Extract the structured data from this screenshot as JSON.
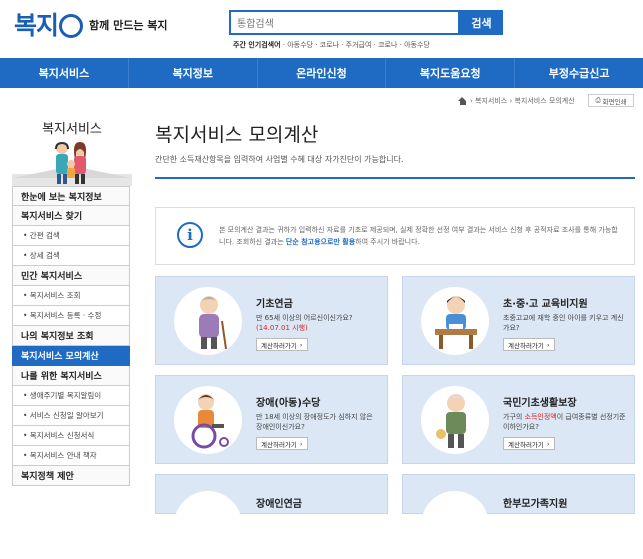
{
  "header": {
    "logo_text": "복지",
    "slogan": "함께 만드는 복지",
    "search_placeholder": "통합검색",
    "search_button": "검색",
    "popular_label": "주간 인기검색어",
    "popular_terms": "· 아동수당 · 코로나 · 주거급여 · 코로나 · 아동수당"
  },
  "nav": {
    "items": [
      "복지서비스",
      "복지정보",
      "온라인신청",
      "복지도움요청",
      "부정수급신고"
    ]
  },
  "breadcrumb": {
    "path": "› 복지서비스 › 복지서비스 모의계산",
    "print": "화면인쇄"
  },
  "sidebar": {
    "title": "복지서비스",
    "items": [
      {
        "label": "한눈에 보는 복지정보",
        "type": "main"
      },
      {
        "label": "복지서비스 찾기",
        "type": "main"
      },
      {
        "label": "• 간편 검색",
        "type": "sub"
      },
      {
        "label": "• 상세 검색",
        "type": "sub"
      },
      {
        "label": "민간 복지서비스",
        "type": "main"
      },
      {
        "label": "• 복지서비스 조회",
        "type": "sub"
      },
      {
        "label": "• 복지서비스 등록 · 수정",
        "type": "sub"
      },
      {
        "label": "나의 복지정보 조회",
        "type": "main"
      },
      {
        "label": "복지서비스 모의계산",
        "type": "active"
      },
      {
        "label": "나를 위한 복지서비스",
        "type": "main"
      },
      {
        "label": "• 생애주기별 복지알림이",
        "type": "sub"
      },
      {
        "label": "• 서비스 신청일 알아보기",
        "type": "sub"
      },
      {
        "label": "• 복지서비스 신청서식",
        "type": "sub"
      },
      {
        "label": "• 복지서비스 안내 책자",
        "type": "sub"
      },
      {
        "label": "복지정책 제안",
        "type": "main"
      }
    ]
  },
  "main": {
    "title": "복지서비스 모의계산",
    "description": "간단한 소득재산항목을 입력하여 사업별 수혜 대상 자가진단이 가능합니다.",
    "notice_1": "본 모의계산 결과는 귀하가 입력하신 자료를 기초로 제공되며, 실제 정확한 선정 여부 결과는 서비스 신청 후 공적자료 조사를 통해 가능합니다. 조회하신 결과는 ",
    "notice_hl": "단순 참고용으로만 활용",
    "notice_2": "하여 주시기 바랍니다."
  },
  "cards": [
    {
      "title": "기초연금",
      "desc": "만 65세 이상의 어르신이신가요?",
      "desc_red": "(14.07.01 시행)",
      "button": "계산하러가기"
    },
    {
      "title": "초·중·고 교육비지원",
      "desc": "초중고교에 재학 중인 아이를 키우고 계신가요?",
      "desc_red": "",
      "button": "계산하러가기"
    },
    {
      "title": "장애(아동)수당",
      "desc": "만 18세 이상의 장애정도가 심하지 않은 장애인이신가요?",
      "desc_red": "",
      "button": "계산하러가기"
    },
    {
      "title": "국민기초생활보장",
      "desc_pre": "가구의 ",
      "desc_red": "소득인정액",
      "desc_post": "이 급여종류별 선정기준 이하인가요?",
      "button": "계산하러가기"
    },
    {
      "title": "장애인연금"
    },
    {
      "title": "한부모가족지원"
    }
  ],
  "colors": {
    "primary": "#1f6bc4",
    "card_bg": "#dbe7f5",
    "accent_red": "#d22222"
  }
}
